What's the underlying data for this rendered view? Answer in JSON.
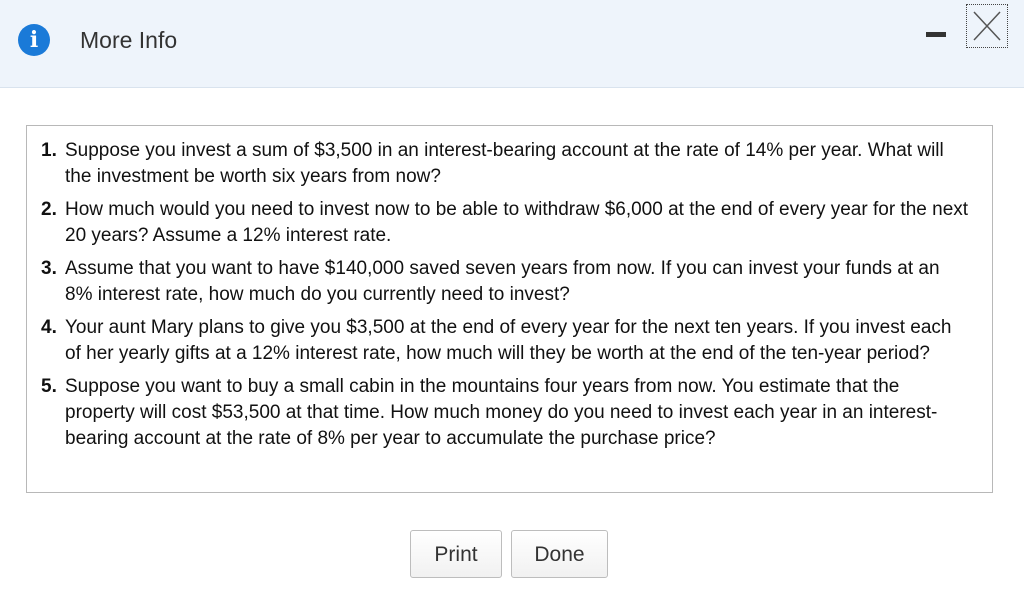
{
  "dialog": {
    "title": "More Info",
    "info_icon": "i",
    "icons": {
      "info": "info-icon",
      "minimize": "minimize-icon",
      "close": "close-icon"
    },
    "colors": {
      "header_background": "#eef4fb",
      "info_icon": "#1a7ad8"
    }
  },
  "questions": [
    {
      "number": "1.",
      "text": "Suppose you invest a sum of $3,500 in an interest-bearing account at the rate of 14% per year. What will the investment be worth six years from now?"
    },
    {
      "number": "2.",
      "text": "How much would you need to invest now to be able to withdraw $6,000 at the end of every year for the next 20 years? Assume a 12% interest rate."
    },
    {
      "number": "3.",
      "text": "Assume that you want to have $140,000 saved seven years from now. If you can invest your funds at an 8% interest rate, how much do you currently need to invest?"
    },
    {
      "number": "4.",
      "text": "Your aunt Mary plans to give you $3,500 at the end of every year for the next ten years. If you invest each of her yearly gifts at a 12% interest rate, how much will they be worth at the end of the ten-year period?"
    },
    {
      "number": "5.",
      "text": "Suppose you want to buy a small cabin in the mountains four years from now. You estimate that the property will cost $53,500 at that time. How much money do you need to invest each year in an interest-bearing account at the rate of 8% per year to accumulate the purchase price?"
    }
  ],
  "buttons": {
    "print_label": "Print",
    "done_label": "Done"
  }
}
